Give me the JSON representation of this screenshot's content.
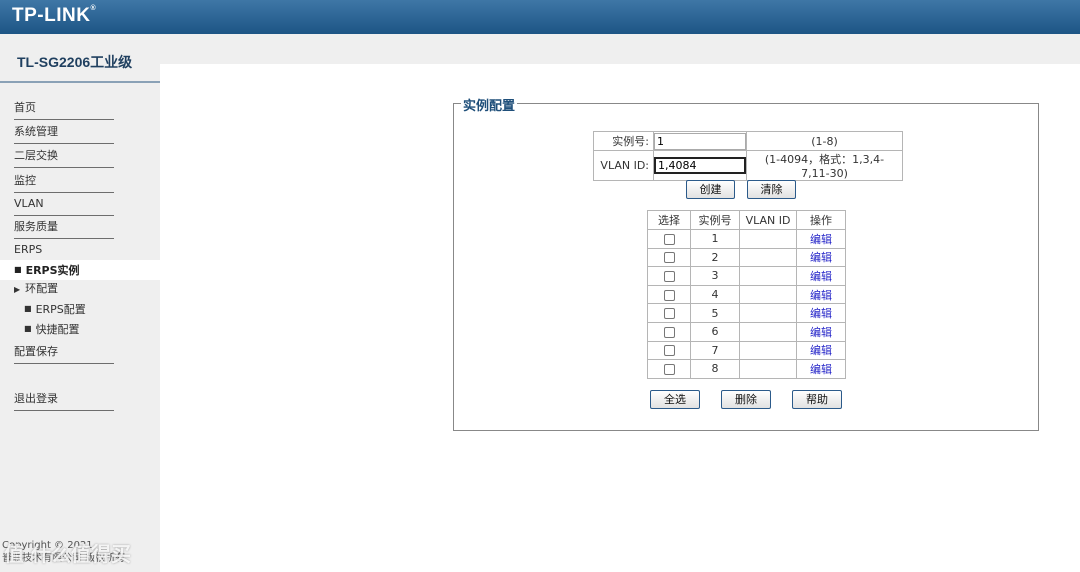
{
  "brand": {
    "logo": "TP-LINK",
    "logo_mark": "®"
  },
  "sidebar": {
    "model": "TL-SG2206工业级",
    "items": [
      {
        "label": "首页"
      },
      {
        "label": "系统管理"
      },
      {
        "label": "二层交换"
      },
      {
        "label": "监控"
      },
      {
        "label": "VLAN"
      },
      {
        "label": "服务质量"
      },
      {
        "label": "ERPS"
      },
      {
        "label": "ERPS实例",
        "active": true
      },
      {
        "label": "环配置"
      },
      {
        "label": "ERPS配置"
      },
      {
        "label": "快捷配置"
      },
      {
        "label": "配置保存"
      },
      {
        "label": "退出登录"
      }
    ],
    "copyright_line1": "Copyright © 2021",
    "copyright_line2": "普联技术有限公司 版权所有"
  },
  "panel": {
    "title": "实例配置",
    "instance_label": "实例号:",
    "instance_value": "1",
    "instance_hint": "(1-8)",
    "vlan_label": "VLAN ID:",
    "vlan_value": "1,4084",
    "vlan_hint": "(1-4094，格式：1,3,4-7,11-30)",
    "create_btn": "创建",
    "clear_btn": "清除",
    "table": {
      "headers": [
        "选择",
        "实例号",
        "VLAN ID",
        "操作"
      ],
      "rows": [
        {
          "id": "1",
          "vlan": "",
          "action": "编辑"
        },
        {
          "id": "2",
          "vlan": "",
          "action": "编辑"
        },
        {
          "id": "3",
          "vlan": "",
          "action": "编辑"
        },
        {
          "id": "4",
          "vlan": "",
          "action": "编辑"
        },
        {
          "id": "5",
          "vlan": "",
          "action": "编辑"
        },
        {
          "id": "6",
          "vlan": "",
          "action": "编辑"
        },
        {
          "id": "7",
          "vlan": "",
          "action": "编辑"
        },
        {
          "id": "8",
          "vlan": "",
          "action": "编辑"
        }
      ]
    },
    "select_all_btn": "全选",
    "delete_btn": "删除",
    "help_btn": "帮助"
  },
  "watermark": "值 什么值得买",
  "colors": {
    "topbar": "#2b6596",
    "sidebar_bg": "#efefef",
    "link": "#2323c8",
    "button_border": "#2b5a8a"
  }
}
